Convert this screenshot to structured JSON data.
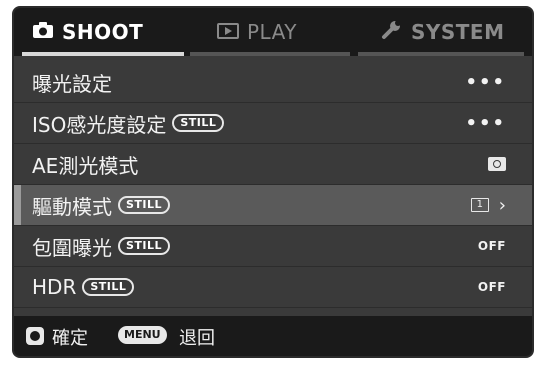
{
  "tabs": [
    {
      "label": "SHOOT",
      "icon": "camera-icon",
      "active": true
    },
    {
      "label": "PLAY",
      "icon": "play-icon",
      "active": false
    },
    {
      "label": "SYSTEM",
      "icon": "wrench-icon",
      "active": false
    }
  ],
  "menu": {
    "rows": [
      {
        "label": "曝光設定",
        "badge": "",
        "value": "•••"
      },
      {
        "label": "ISO感光度設定",
        "badge": "STILL",
        "value": "•••"
      },
      {
        "label": "AE測光模式",
        "badge": "",
        "value": "",
        "value_icon": "metering-icon"
      },
      {
        "label": "驅動模式",
        "badge": "STILL",
        "value": "1",
        "value_icon": "single-drive-icon",
        "selected": true
      },
      {
        "label": "包圍曝光",
        "badge": "STILL",
        "value": "OFF"
      },
      {
        "label": "HDR",
        "badge": "STILL",
        "value": "OFF"
      }
    ]
  },
  "bottom": {
    "ok_label": "確定",
    "menu_button": "MENU",
    "back_label": "退回"
  },
  "colors": {
    "background": "#3a3a3a",
    "bar": "#1a1a1a",
    "selected_row": "#5a5a5a",
    "text": "#f2f2f2"
  }
}
